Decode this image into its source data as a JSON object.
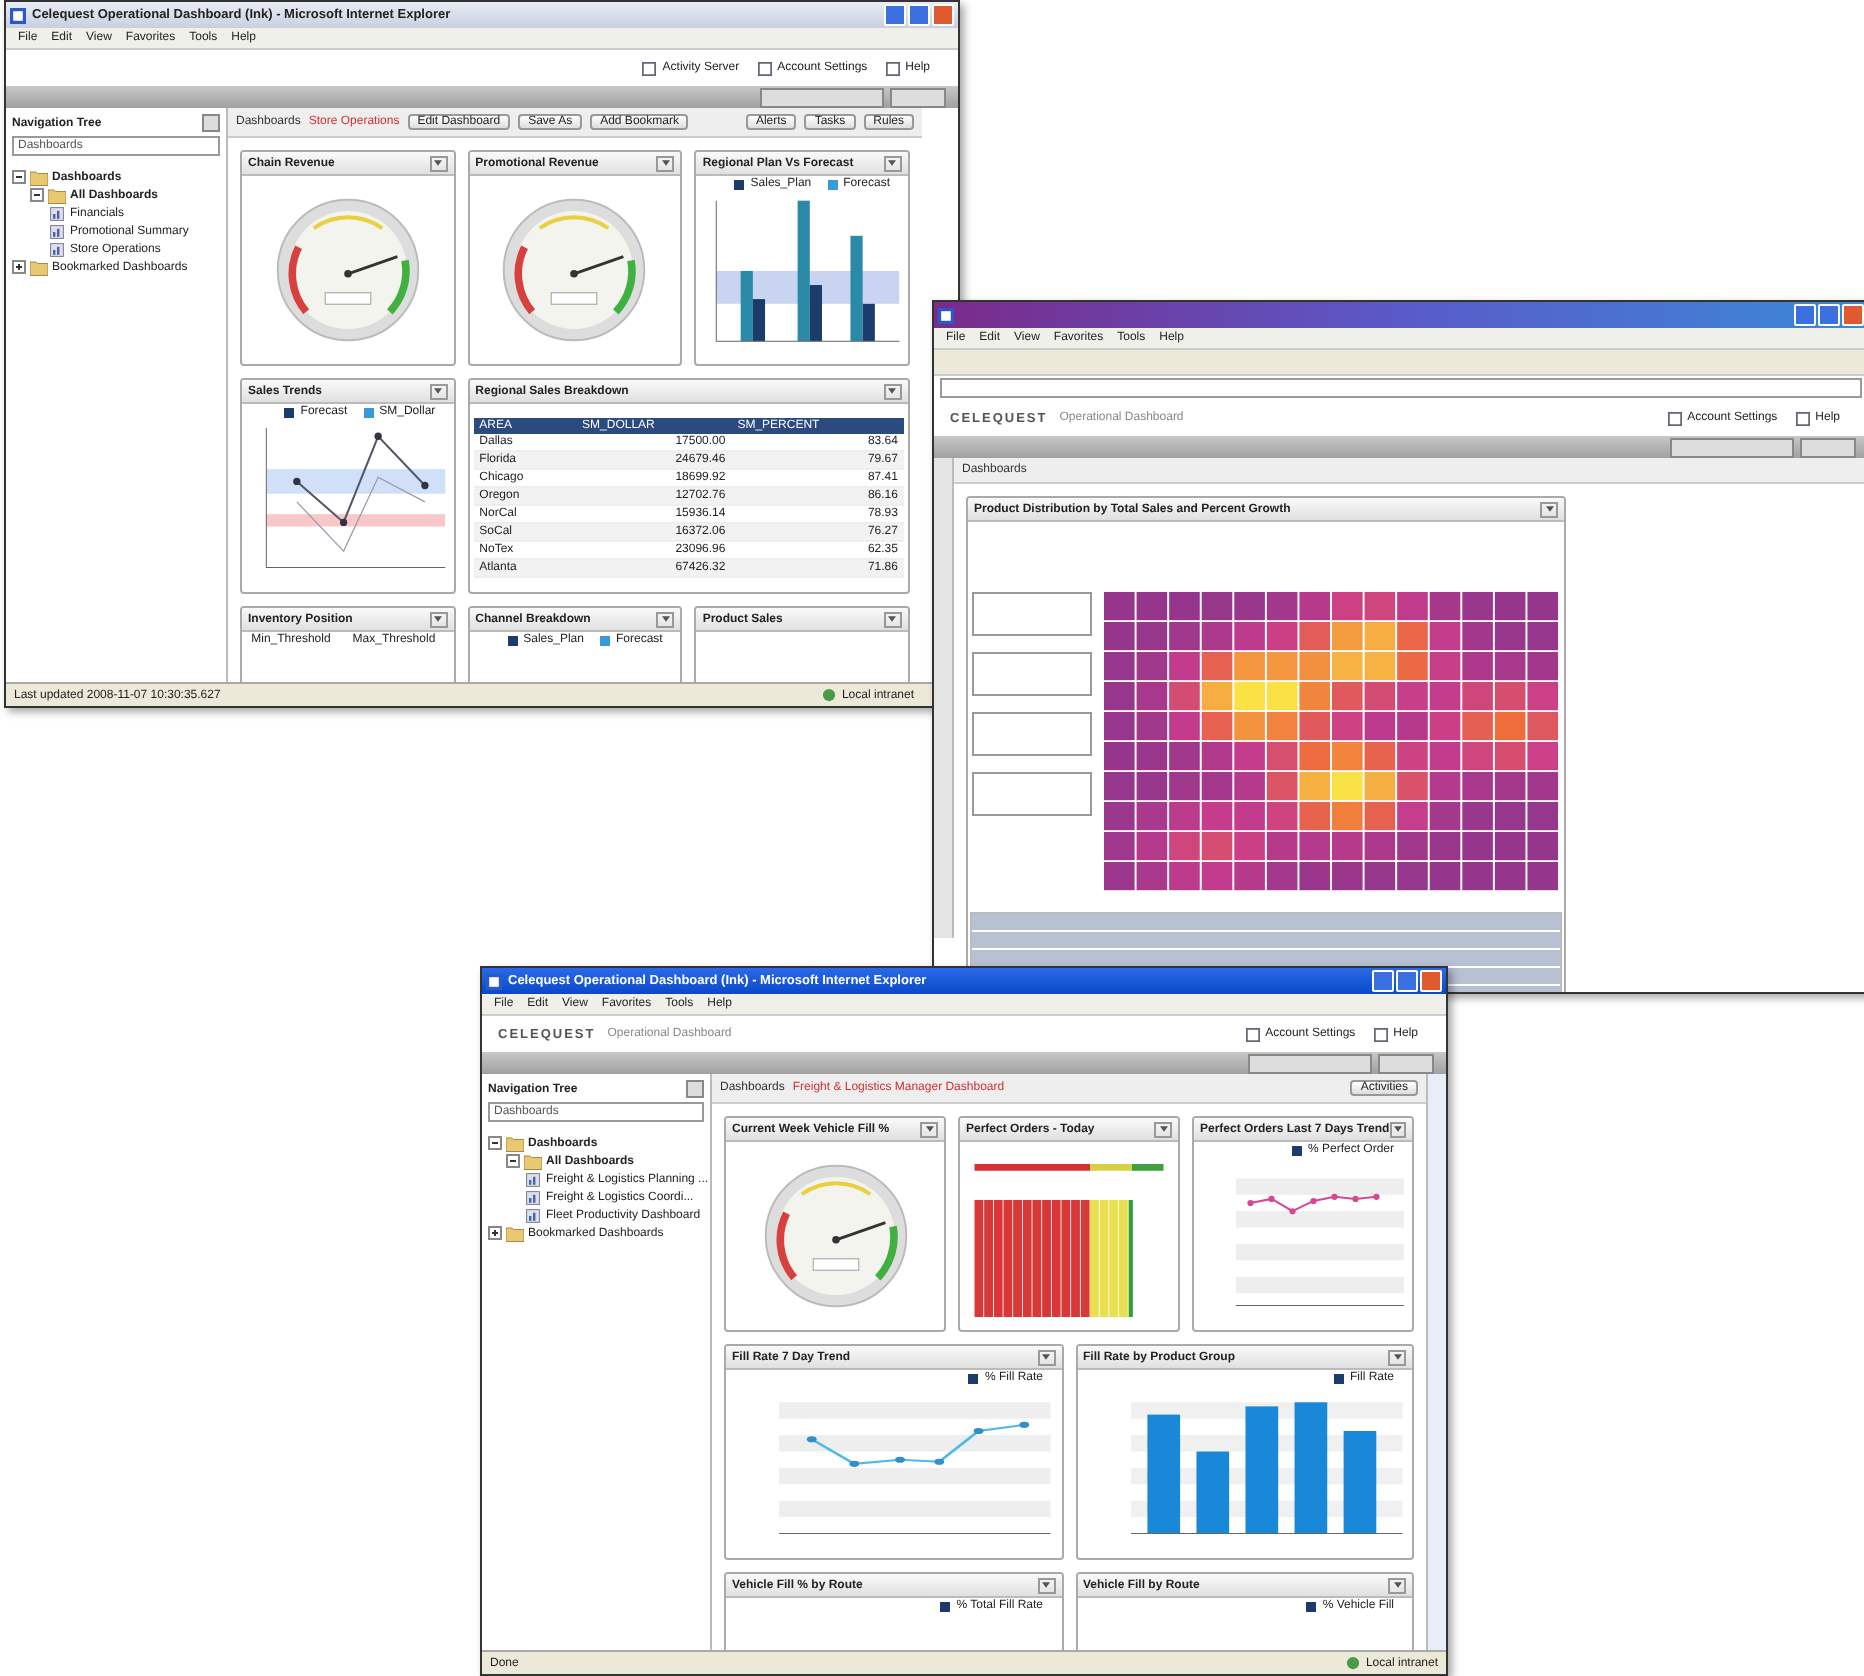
{
  "windows": [
    {
      "kind": "store",
      "title": "Celequest Operational Dashboard (Ink) - Microsoft Internet Explorer",
      "menu": [
        "File",
        "Edit",
        "View",
        "Favorites",
        "Tools",
        "Help"
      ],
      "header_links": [
        "Activity Server",
        "Account Settings",
        "Help"
      ],
      "nav": {
        "title": "Navigation Tree",
        "dropdown": "Dashboards",
        "tree": [
          {
            "label": "Dashboards",
            "expanded": true,
            "children": [
              {
                "label": "All Dashboards",
                "expanded": true,
                "children": [
                  {
                    "label": "Financials"
                  },
                  {
                    "label": "Promotional Summary"
                  },
                  {
                    "label": "Store Operations"
                  }
                ]
              }
            ]
          },
          {
            "label": "Bookmarked Dashboards",
            "expanded": false
          }
        ]
      },
      "breadcrumb": {
        "root": "Dashboards",
        "current": "Store Operations"
      },
      "buttons": [
        "Edit Dashboard",
        "Save As",
        "Add Bookmark"
      ],
      "menus": [
        "Alerts",
        "Tasks",
        "Rules"
      ],
      "panels": [
        {
          "title": "Chain Revenue",
          "kind": "gauge"
        },
        {
          "title": "Promotional Revenue",
          "kind": "gauge"
        },
        {
          "title": "Regional Plan Vs Forecast",
          "kind": "bars",
          "legend": [
            "Sales_Plan",
            "Forecast"
          ]
        },
        {
          "title": "Sales Trends",
          "kind": "line",
          "legend": [
            "Forecast",
            "SM_Dollar"
          ]
        },
        {
          "title": "Regional Sales Breakdown",
          "kind": "table",
          "columns": [
            "AREA",
            "SM_DOLLAR",
            "SM_PERCENT"
          ],
          "rows": [
            [
              "Dallas",
              "17500.00",
              "83.64"
            ],
            [
              "Florida",
              "24679.46",
              "79.67"
            ],
            [
              "Chicago",
              "18699.92",
              "87.41"
            ],
            [
              "Oregon",
              "12702.76",
              "86.16"
            ],
            [
              "NorCal",
              "15936.14",
              "78.93"
            ],
            [
              "SoCal",
              "16372.06",
              "76.27"
            ],
            [
              "NoTex",
              "23096.96",
              "62.35"
            ],
            [
              "Atlanta",
              "67426.32",
              "71.86"
            ]
          ]
        },
        {
          "title": "Inventory Position",
          "kind": "empty",
          "legend": [
            "Min_Threshold",
            "Max_Threshold"
          ]
        },
        {
          "title": "Channel Breakdown",
          "kind": "empty",
          "legend": [
            "Sales_Plan",
            "Forecast"
          ]
        },
        {
          "title": "Product Sales",
          "kind": "empty"
        }
      ],
      "status": "Last updated 2008-11-07 10:30:35.627",
      "zone": "Local intranet"
    },
    {
      "kind": "analysis",
      "brand": "CELEQUEST",
      "subtitle": "Operational Dashboard",
      "menu": [
        "File",
        "Edit",
        "View",
        "Favorites",
        "Tools",
        "Help"
      ],
      "header_links": [
        "Account Settings",
        "Help"
      ],
      "breadcrumb": {
        "root": "Dashboards"
      },
      "panels": [
        {
          "title": "Product Distribution by Total Sales and Percent Growth",
          "kind": "heatmap"
        }
      ]
    },
    {
      "kind": "logistics",
      "title": "Celequest Operational Dashboard (Ink) - Microsoft Internet Explorer",
      "brand": "CELEQUEST",
      "subtitle": "Operational Dashboard",
      "menu": [
        "File",
        "Edit",
        "View",
        "Favorites",
        "Tools",
        "Help"
      ],
      "header_links": [
        "Account Settings",
        "Help"
      ],
      "nav": {
        "title": "Navigation Tree",
        "dropdown": "Dashboards",
        "tree": [
          {
            "label": "Dashboards",
            "expanded": true,
            "children": [
              {
                "label": "All Dashboards",
                "expanded": true,
                "children": [
                  {
                    "label": "Freight & Logistics Planning ..."
                  },
                  {
                    "label": "Freight & Logistics Coordi..."
                  },
                  {
                    "label": "Fleet Productivity Dashboard"
                  }
                ]
              }
            ]
          },
          {
            "label": "Bookmarked Dashboards",
            "expanded": false
          }
        ]
      },
      "breadcrumb": {
        "root": "Dashboards",
        "current": "Freight & Logistics Manager Dashboard"
      },
      "menus": [
        "Activities"
      ],
      "panels": [
        {
          "title": "Current Week Vehicle Fill %",
          "kind": "gauge"
        },
        {
          "title": "Perfect Orders - Today",
          "kind": "stripes"
        },
        {
          "title": "Perfect Orders Last 7 Days Trend",
          "kind": "dots",
          "legend": [
            "% Perfect Order"
          ]
        },
        {
          "title": "Fill Rate 7 Day Trend",
          "kind": "line2",
          "legend": [
            "% Fill Rate"
          ]
        },
        {
          "title": "Fill Rate by Product Group",
          "kind": "columns",
          "legend": [
            "Fill Rate"
          ]
        },
        {
          "title": "Vehicle Fill % by Route",
          "kind": "empty",
          "legend": [
            "% Total Fill Rate"
          ]
        },
        {
          "title": "Vehicle Fill by Route",
          "kind": "empty",
          "legend": [
            "% Vehicle Fill"
          ]
        }
      ],
      "status": "Done",
      "zone": "Local intranet"
    }
  ]
}
